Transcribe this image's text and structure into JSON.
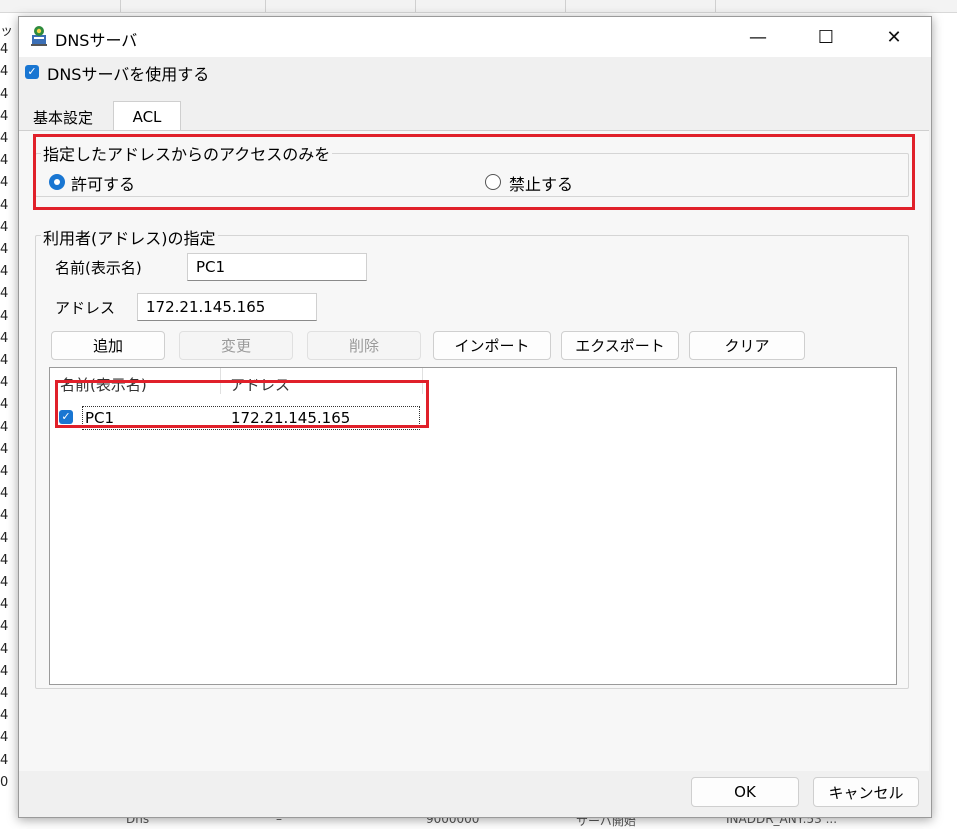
{
  "background": {
    "left_column": [
      "ッ",
      "4",
      "4",
      "4",
      "4",
      "4",
      "4",
      "4",
      "4",
      "4",
      "4",
      "4",
      "4",
      "4",
      "4",
      "4",
      "4",
      "4",
      "4",
      "4",
      "4",
      "4",
      "4",
      "4",
      "4",
      "4",
      "4",
      "4",
      "4",
      "4",
      "4",
      "4",
      "4",
      "4",
      "0"
    ],
    "bottom_row": [
      "Dns",
      "–",
      "9000000",
      "サーバ開始",
      "INADDR_ANY:53 ..."
    ]
  },
  "window": {
    "title": "DNSサーバ",
    "minimize": "—",
    "maximize": "☐",
    "close": "✕"
  },
  "use_dns": {
    "checked": true,
    "label": "DNSサーバを使用する"
  },
  "tabs": {
    "basic": "基本設定",
    "acl": "ACL"
  },
  "access": {
    "group_title": "指定したアドレスからのアクセスのみを",
    "allow": "許可する",
    "deny": "禁止する",
    "selected": "allow"
  },
  "user": {
    "group_title": "利用者(アドレス)の指定",
    "name_label": "名前(表示名)",
    "name_value": "PC1",
    "address_label": "アドレス",
    "address_value": "172.21.145.165"
  },
  "buttons": {
    "add": "追加",
    "change": "変更",
    "delete": "削除",
    "import": "インポート",
    "export": "エクスポート",
    "clear": "クリア"
  },
  "list": {
    "col_name": "名前(表示名)",
    "col_address": "アドレス",
    "rows": [
      {
        "checked": true,
        "name": "PC1",
        "address": "172.21.145.165"
      }
    ]
  },
  "footer": {
    "ok": "OK",
    "cancel": "キャンセル"
  },
  "colors": {
    "accent": "#1976d2",
    "highlight": "#e0202a"
  }
}
